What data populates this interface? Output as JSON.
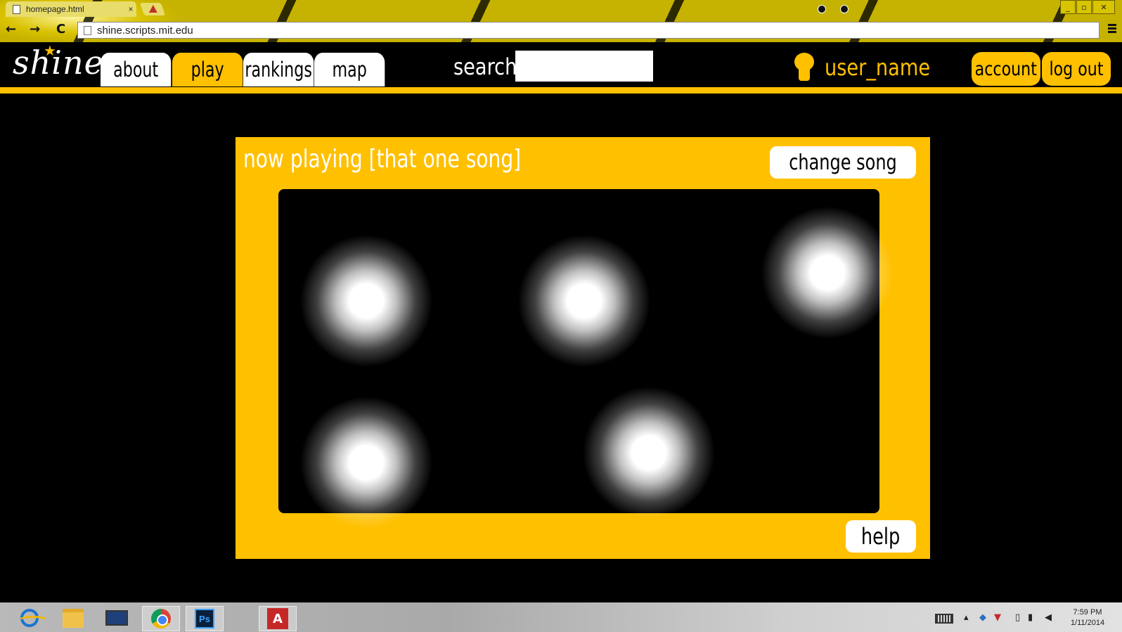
{
  "browser": {
    "tab_title": "homepage.html",
    "tab_close": "×",
    "url": "shine.scripts.mit.edu",
    "back_icon": "←",
    "forward_icon": "→",
    "reload_icon": "C"
  },
  "site": {
    "logo": "shine",
    "logo_star": "★",
    "nav": [
      {
        "label": "about",
        "active": false
      },
      {
        "label": "play",
        "active": true
      },
      {
        "label": "rankings",
        "active": false
      },
      {
        "label": "map",
        "active": false
      }
    ],
    "search_label": "search",
    "search_value": "",
    "username": "user_name",
    "account_label": "account",
    "logout_label": "log out"
  },
  "player": {
    "now_playing": "now playing [that one song]",
    "change_song_label": "change song",
    "help_label": "help",
    "lights_count": 5
  },
  "taskbar": {
    "apps": [
      "internet-explorer",
      "file-explorer",
      "lenovo",
      "chrome",
      "photoshop",
      "red-app"
    ],
    "ps_label": "Ps",
    "red_label": "A",
    "time": "7:59 PM",
    "date": "1/11/2014"
  },
  "colors": {
    "accent": "#ffc000",
    "chrome_bar": "#c6b200",
    "background": "#000000"
  }
}
